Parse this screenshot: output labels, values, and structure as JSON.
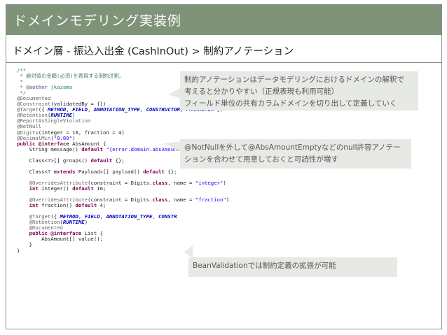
{
  "title": "ドメインモデリング実装例",
  "subtitle": "ドメイン層 - 振込入出金 (CashInOut) > 制約アノテーション",
  "code_lines": [
    [
      {
        "c": "c-com",
        "t": "/**"
      }
    ],
    [
      {
        "c": "c-com",
        "t": " * "
      },
      {
        "c": "c-jp",
        "t": "絶対値の金額(必須)を表現する制約注釈。"
      }
    ],
    [
      {
        "c": "c-com",
        "t": " *"
      }
    ],
    [
      {
        "c": "c-com",
        "t": " * "
      },
      {
        "c": "c-doc",
        "t": "@author"
      },
      {
        "c": "c-com",
        "t": " jkazama"
      }
    ],
    [
      {
        "c": "c-com",
        "t": " */"
      }
    ],
    [
      {
        "c": "c-ann",
        "t": "@Documented"
      }
    ],
    [
      {
        "c": "c-ann",
        "t": "@Constraint"
      },
      {
        "c": "",
        "t": "(validatedBy = {})"
      }
    ],
    [
      {
        "c": "c-ann",
        "t": "@Target"
      },
      {
        "c": "",
        "t": "({ "
      },
      {
        "c": "c-con",
        "t": "METHOD"
      },
      {
        "c": "",
        "t": ", "
      },
      {
        "c": "c-con",
        "t": "FIELD"
      },
      {
        "c": "",
        "t": ", "
      },
      {
        "c": "c-con",
        "t": "ANNOTATION_TYPE"
      },
      {
        "c": "",
        "t": ", "
      },
      {
        "c": "c-con",
        "t": "CONSTRUCTOR"
      },
      {
        "c": "",
        "t": ", "
      },
      {
        "c": "c-con",
        "t": "PARAMETER"
      },
      {
        "c": "",
        "t": " })"
      }
    ],
    [
      {
        "c": "c-ann",
        "t": "@Retention"
      },
      {
        "c": "",
        "t": "("
      },
      {
        "c": "c-con",
        "t": "RUNTIME"
      },
      {
        "c": "",
        "t": ")"
      }
    ],
    [
      {
        "c": "c-ann",
        "t": "@ReportAsSingleViolation"
      }
    ],
    [
      {
        "c": "c-ann",
        "t": "@NotNull"
      }
    ],
    [
      {
        "c": "c-ann",
        "t": "@Digits"
      },
      {
        "c": "",
        "t": "(integer = 16, fraction = 4)"
      }
    ],
    [
      {
        "c": "c-ann",
        "t": "@DecimalMin"
      },
      {
        "c": "",
        "t": "("
      },
      {
        "c": "c-str",
        "t": "\"0.00\""
      },
      {
        "c": "",
        "t": ")"
      }
    ],
    [
      {
        "c": "c-kw",
        "t": "public @interface"
      },
      {
        "c": "",
        "t": " AbsAmount {"
      }
    ],
    [
      {
        "c": "",
        "t": "    String message() "
      },
      {
        "c": "c-kw",
        "t": "default"
      },
      {
        "c": "",
        "t": " "
      },
      {
        "c": "c-str",
        "t": "\"{error.domain.absAmount}\""
      },
      {
        "c": "",
        "t": ";"
      }
    ],
    [
      {
        "c": "",
        "t": ""
      }
    ],
    [
      {
        "c": "",
        "t": "    Class<?>[] groups() "
      },
      {
        "c": "c-kw",
        "t": "default"
      },
      {
        "c": "",
        "t": " {};"
      }
    ],
    [
      {
        "c": "",
        "t": ""
      }
    ],
    [
      {
        "c": "",
        "t": "    Class<? "
      },
      {
        "c": "c-kw",
        "t": "extends"
      },
      {
        "c": "",
        "t": " Payload>[] payload() "
      },
      {
        "c": "c-kw",
        "t": "default"
      },
      {
        "c": "",
        "t": " {};"
      }
    ],
    [
      {
        "c": "",
        "t": ""
      }
    ],
    [
      {
        "c": "",
        "t": "    "
      },
      {
        "c": "c-ann",
        "t": "@OverridesAttribute"
      },
      {
        "c": "",
        "t": "(constraint = Digits."
      },
      {
        "c": "c-kw",
        "t": "class"
      },
      {
        "c": "",
        "t": ", name = "
      },
      {
        "c": "c-str",
        "t": "\"integer\""
      },
      {
        "c": "",
        "t": ")"
      }
    ],
    [
      {
        "c": "",
        "t": "    "
      },
      {
        "c": "c-kw",
        "t": "int"
      },
      {
        "c": "",
        "t": " integer() "
      },
      {
        "c": "c-kw",
        "t": "default"
      },
      {
        "c": "",
        "t": " 16;"
      }
    ],
    [
      {
        "c": "",
        "t": ""
      }
    ],
    [
      {
        "c": "",
        "t": "    "
      },
      {
        "c": "c-ann",
        "t": "@OverridesAttribute"
      },
      {
        "c": "",
        "t": "(constraint = Digits."
      },
      {
        "c": "c-kw",
        "t": "class"
      },
      {
        "c": "",
        "t": ", name = "
      },
      {
        "c": "c-str",
        "t": "\"fraction\""
      },
      {
        "c": "",
        "t": ")"
      }
    ],
    [
      {
        "c": "",
        "t": "    "
      },
      {
        "c": "c-kw",
        "t": "int"
      },
      {
        "c": "",
        "t": " fraction() "
      },
      {
        "c": "c-kw",
        "t": "default"
      },
      {
        "c": "",
        "t": " 4;"
      }
    ],
    [
      {
        "c": "",
        "t": ""
      }
    ],
    [
      {
        "c": "",
        "t": "    "
      },
      {
        "c": "c-ann",
        "t": "@Target"
      },
      {
        "c": "",
        "t": "({ "
      },
      {
        "c": "c-con",
        "t": "METHOD"
      },
      {
        "c": "",
        "t": ", "
      },
      {
        "c": "c-con",
        "t": "FIELD"
      },
      {
        "c": "",
        "t": ", "
      },
      {
        "c": "c-con",
        "t": "ANNOTATION_TYPE"
      },
      {
        "c": "",
        "t": ", "
      },
      {
        "c": "c-con",
        "t": "CONSTR"
      }
    ],
    [
      {
        "c": "",
        "t": "    "
      },
      {
        "c": "c-ann",
        "t": "@Retention"
      },
      {
        "c": "",
        "t": "("
      },
      {
        "c": "c-con",
        "t": "RUNTIME"
      },
      {
        "c": "",
        "t": ")"
      }
    ],
    [
      {
        "c": "",
        "t": "    "
      },
      {
        "c": "c-ann",
        "t": "@Documented"
      }
    ],
    [
      {
        "c": "",
        "t": "    "
      },
      {
        "c": "c-kw",
        "t": "public @interface"
      },
      {
        "c": "",
        "t": " List {"
      }
    ],
    [
      {
        "c": "",
        "t": "        AbsAmount[] value();"
      }
    ],
    [
      {
        "c": "",
        "t": "    }"
      }
    ],
    [
      {
        "c": "",
        "t": "}"
      }
    ]
  ],
  "callouts": {
    "c1": [
      "制約アノテーションはデータモデリングにおけるドメインの解釈で",
      "考えると分かりやすい（正規表現も利用可能）",
      "フィールド単位の共有カラムドメインを切り出して定義していく"
    ],
    "c2": [
      "@NotNullを外して@AbsAmountEmptyなどのnull許容アノテー",
      "ションを合わせて用意しておくと可読性が増す"
    ],
    "c3": [
      "BeanValidationでは制約定義の拡張が可能"
    ]
  }
}
